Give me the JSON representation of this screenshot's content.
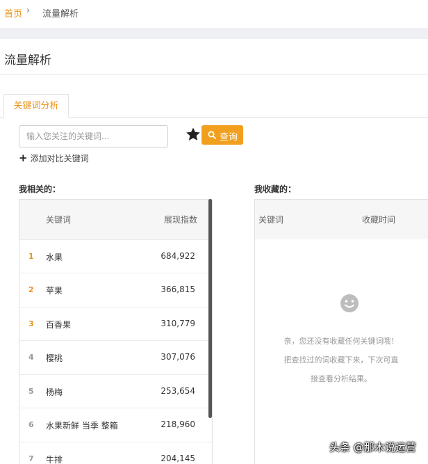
{
  "breadcrumb": {
    "home": "首页",
    "separator": "›",
    "current": "流量解析"
  },
  "page_title": "流量解析",
  "tab": {
    "label": "关键词分析"
  },
  "search": {
    "placeholder": "输入您关注的关键词...",
    "value": ""
  },
  "query_button": {
    "label": "查询",
    "icon": "search-icon"
  },
  "favorite_icon": "star-icon",
  "add_compare": {
    "label": "添加对比关键词"
  },
  "related": {
    "title": "我相关的：",
    "columns": [
      "关键词",
      "展现指数"
    ],
    "rows": [
      {
        "rank": "1",
        "keyword": "水果",
        "value": "684,922"
      },
      {
        "rank": "2",
        "keyword": "苹果",
        "value": "366,815"
      },
      {
        "rank": "3",
        "keyword": "百香果",
        "value": "310,779"
      },
      {
        "rank": "4",
        "keyword": "樱桃",
        "value": "307,076"
      },
      {
        "rank": "5",
        "keyword": "杨梅",
        "value": "253,654"
      },
      {
        "rank": "6",
        "keyword": "水果新鲜 当季 整箱",
        "value": "218,960"
      },
      {
        "rank": "7",
        "keyword": "牛排",
        "value": "204,145"
      }
    ]
  },
  "favorites": {
    "title": "我收藏的：",
    "columns": [
      "关键词",
      "收藏时间"
    ],
    "empty_lines": [
      "亲，您还没有收藏任何关键词哦！",
      "把查找过的词收藏下来，下次可直",
      "接查看分析结果。"
    ]
  },
  "watermark": "头条 @那木说运营",
  "colors": {
    "accent": "#f0a01e",
    "top_rank": "#e8941a",
    "other_rank": "#999999"
  }
}
